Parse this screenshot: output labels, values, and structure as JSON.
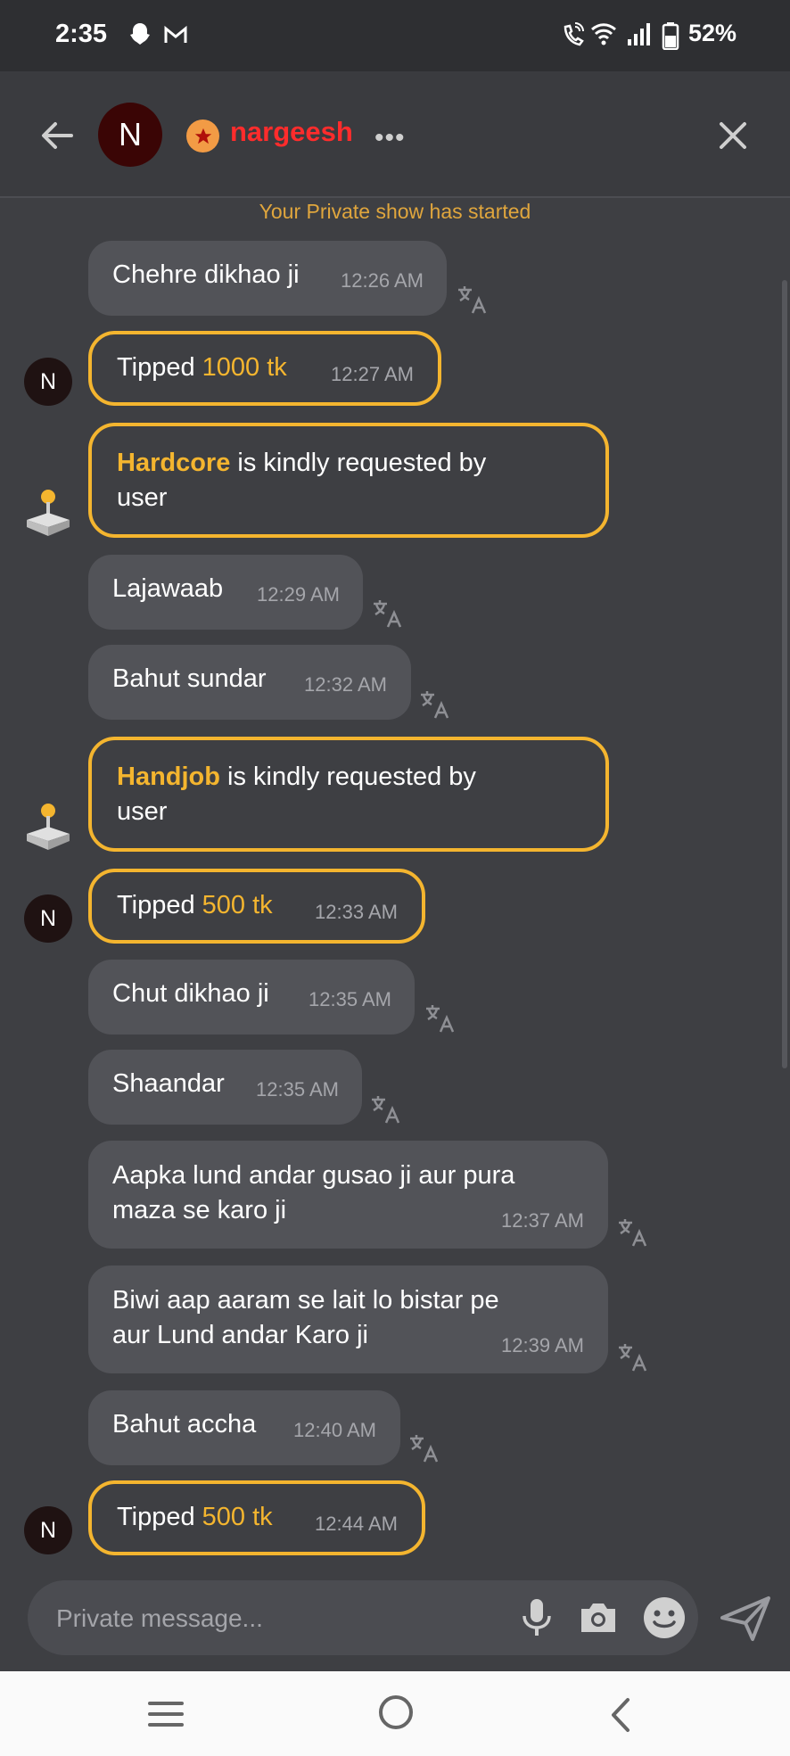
{
  "status_bar": {
    "time": "2:35",
    "battery": "52%",
    "icons": [
      "snapchat-icon",
      "gmail-icon",
      "wifi-call-icon",
      "wifi-icon",
      "signal-icon",
      "battery-icon"
    ]
  },
  "header": {
    "avatar_initial": "N",
    "username": "nargeesh",
    "more": "•••",
    "badge_icon": "star-icon"
  },
  "notice": "Your Private show has started",
  "messages": [
    {
      "type": "text",
      "text": "Chehre dikhao ji",
      "time": "12:26 AM"
    },
    {
      "type": "tip",
      "prefix": "Tipped",
      "amount": "1000 tk",
      "time": "12:27 AM",
      "avatar": "N"
    },
    {
      "type": "request",
      "highlight": "Hardcore",
      "rest": " is kindly requested by",
      "line2": "user"
    },
    {
      "type": "text",
      "text": "Lajawaab",
      "time": "12:29 AM"
    },
    {
      "type": "text",
      "text": "Bahut sundar",
      "time": "12:32 AM"
    },
    {
      "type": "request",
      "highlight": "Handjob",
      "rest": " is kindly requested by",
      "line2": "user"
    },
    {
      "type": "tip",
      "prefix": "Tipped",
      "amount": "500 tk",
      "time": "12:33 AM",
      "avatar": "N"
    },
    {
      "type": "text",
      "text": "Chut dikhao ji",
      "time": "12:35 AM"
    },
    {
      "type": "text",
      "text": "Shaandar",
      "time": "12:35 AM"
    },
    {
      "type": "text",
      "line1": "Aapka lund andar gusao ji aur pura",
      "line2": "maza se karo ji",
      "time": "12:37 AM"
    },
    {
      "type": "text",
      "line1": "Biwi aap aaram se lait lo bistar pe",
      "line2": "aur Lund andar Karo ji",
      "time": "12:39 AM"
    },
    {
      "type": "text",
      "text": "Bahut accha",
      "time": "12:40 AM"
    },
    {
      "type": "tip",
      "prefix": "Tipped",
      "amount": "500 tk",
      "time": "12:44 AM",
      "avatar": "N"
    }
  ],
  "composer": {
    "placeholder": "Private message..."
  },
  "colors": {
    "background": "#3e3f43",
    "bubble": "#525358",
    "accent": "#f4b52f",
    "username": "#ff2c2c",
    "notice": "#e0a63d"
  }
}
